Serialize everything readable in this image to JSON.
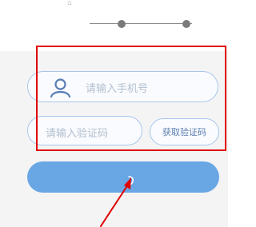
{
  "header": {
    "progress_steps": 2,
    "current_step": 1
  },
  "form": {
    "phone_placeholder": "请输入手机号",
    "code_placeholder": "请输入验证码",
    "get_code_label": "获取验证码",
    "submit_label": ""
  },
  "annotation": {
    "highlight_color": "#e10000",
    "arrow_color": "#e10000"
  },
  "icons": {
    "top_faint": "device-icon",
    "phone_field": "user-icon"
  }
}
